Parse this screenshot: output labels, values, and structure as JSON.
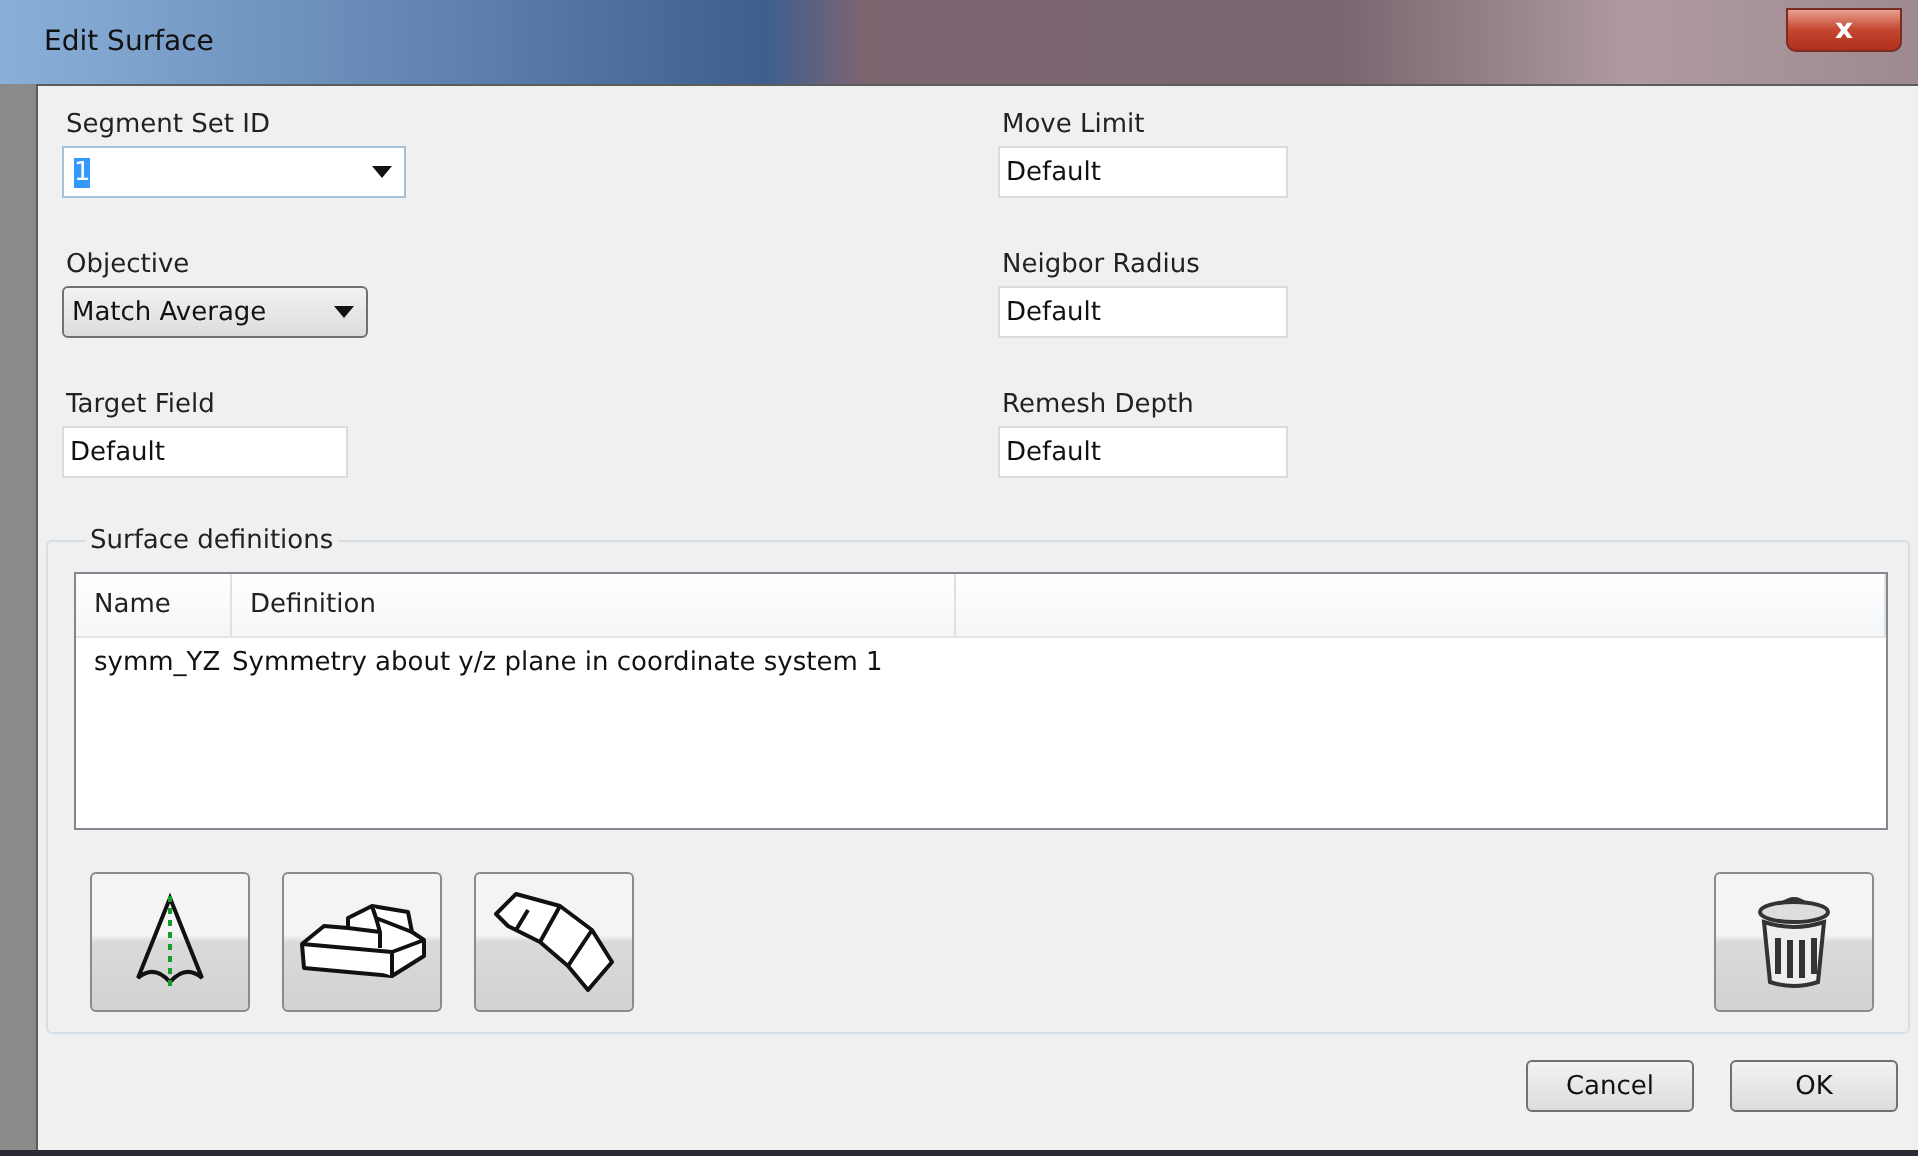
{
  "window": {
    "title": "Edit Surface",
    "close_label": "x"
  },
  "left_fields": [
    {
      "label": "Segment Set ID",
      "kind": "combo",
      "value": "1",
      "value_selected": true
    },
    {
      "label": "Objective",
      "kind": "dropdown",
      "value": "Match Average"
    },
    {
      "label": "Target Field",
      "kind": "text",
      "value": "Default"
    }
  ],
  "right_fields": [
    {
      "label": "Move Limit",
      "kind": "text",
      "value": "Default"
    },
    {
      "label": "Neigbor Radius",
      "kind": "text",
      "value": "Default"
    },
    {
      "label": "Remesh Depth",
      "kind": "text",
      "value": "Default"
    }
  ],
  "surface_definitions": {
    "title": "Surface definitions",
    "columns": [
      "Name",
      "Definition"
    ],
    "rows": [
      {
        "name": "symm_YZ",
        "definition": "Symmetry about y/z plane in coordinate system 1"
      }
    ],
    "tools": [
      {
        "kind": "symmetry"
      },
      {
        "kind": "block"
      },
      {
        "kind": "strip"
      }
    ],
    "delete": {
      "kind": "trash"
    }
  },
  "buttons": [
    "Cancel",
    "OK"
  ]
}
